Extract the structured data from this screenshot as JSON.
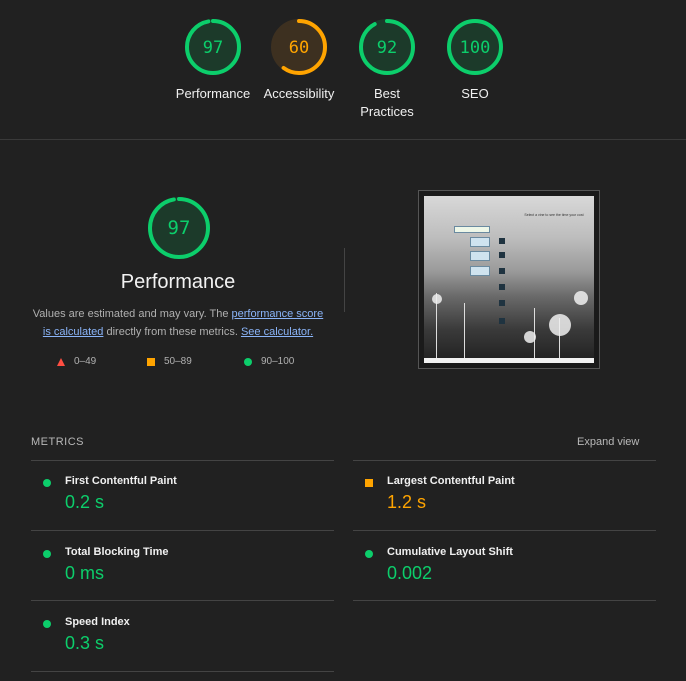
{
  "gauges": [
    {
      "score": "97",
      "label": "Performance",
      "value": 97,
      "color": "#0cce6b",
      "track": "#1c3a2a"
    },
    {
      "score": "60",
      "label": "Accessibility",
      "value": 60,
      "color": "#ffa400",
      "track": "#3d3020"
    },
    {
      "score": "92",
      "label": "Best Practices",
      "value": 92,
      "color": "#0cce6b",
      "track": "#1c3a2a"
    },
    {
      "score": "100",
      "label": "SEO",
      "value": 100,
      "color": "#0cce6b",
      "track": "#1c3a2a"
    }
  ],
  "performance": {
    "score": "97",
    "value": 97,
    "title": "Performance",
    "desc_prefix": "Values are estimated and may vary. The ",
    "desc_link1": "performance score is calculated",
    "desc_middle": " directly from these metrics. ",
    "desc_link2": "See calculator."
  },
  "legend": {
    "fail": "0–49",
    "average": "50–89",
    "pass": "90–100"
  },
  "screenshot": {
    "caption": "Select a vine to see the time your cost"
  },
  "metrics": {
    "heading": "METRICS",
    "expand_label": "Expand view",
    "items": [
      {
        "name": "First Contentful Paint",
        "value": "0.2 s",
        "status": "pass"
      },
      {
        "name": "Largest Contentful Paint",
        "value": "1.2 s",
        "status": "average"
      },
      {
        "name": "Total Blocking Time",
        "value": "0 ms",
        "status": "pass"
      },
      {
        "name": "Cumulative Layout Shift",
        "value": "0.002",
        "status": "pass"
      },
      {
        "name": "Speed Index",
        "value": "0.3 s",
        "status": "pass"
      }
    ]
  },
  "colors": {
    "pass": "#0cce6b",
    "average": "#ffa400",
    "fail": "#ff4e42"
  }
}
